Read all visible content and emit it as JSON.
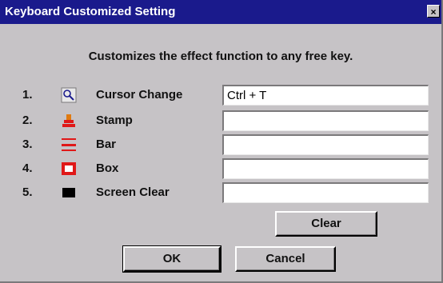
{
  "window": {
    "title": "Keyboard Customized Setting",
    "close_glyph": "×"
  },
  "description": "Customizes the effect function to any free key.",
  "rows": [
    {
      "number": "1.",
      "icon": "cursor-change-icon",
      "label": "Cursor Change",
      "value": "Ctrl + T"
    },
    {
      "number": "2.",
      "icon": "stamp-icon",
      "label": "Stamp",
      "value": ""
    },
    {
      "number": "3.",
      "icon": "bar-icon",
      "label": "Bar",
      "value": ""
    },
    {
      "number": "4.",
      "icon": "box-icon",
      "label": "Box",
      "value": ""
    },
    {
      "number": "5.",
      "icon": "screen-clear-icon",
      "label": "Screen Clear",
      "value": ""
    }
  ],
  "buttons": {
    "clear": "Clear",
    "ok": "OK",
    "cancel": "Cancel"
  },
  "colors": {
    "titlebar": "#1a1a8c",
    "dialog_face": "#c6c3c6",
    "icon_red": "#e01818"
  }
}
